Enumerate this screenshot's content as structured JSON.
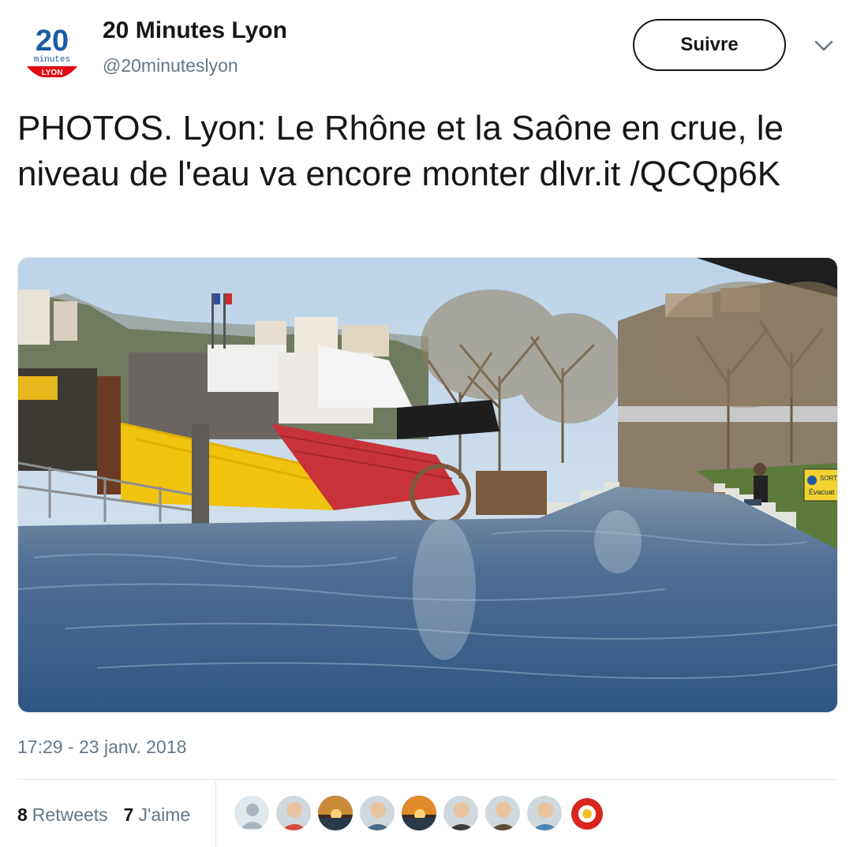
{
  "account": {
    "name": "20 Minutes Lyon",
    "handle": "@20minuteslyon",
    "logo": {
      "number": "20",
      "word": "minutes",
      "city": "LYON",
      "brand_color": "#1d5aa6",
      "accent_color": "#e30613"
    }
  },
  "follow_button": {
    "label": "Suivre"
  },
  "menu": {
    "icon": "chevron-down-icon"
  },
  "tweet": {
    "text": "PHOTOS. Lyon: Le Rhône et la Saône en crue, le niveau de l'eau va encore monter dlvr.it /QCQp6K",
    "timestamp": "17:29 - 23 janv. 2018"
  },
  "photo": {
    "sign_line1": "SORTI",
    "sign_line2": "Évacuat"
  },
  "stats": {
    "retweets_count": "8",
    "retweets_label": "Retweets",
    "likes_count": "7",
    "likes_label": "J'aime"
  },
  "likers": [
    {
      "icon": "default-avatar-icon",
      "color": "#a7b3bd"
    },
    {
      "icon": "person-avatar-icon",
      "color": "#d64a3f"
    },
    {
      "icon": "sunset-avatar-icon",
      "color": "#c98a3a"
    },
    {
      "icon": "person-avatar-icon",
      "color": "#4a6b8a"
    },
    {
      "icon": "sunset-avatar-icon",
      "color": "#e08a2a"
    },
    {
      "icon": "person-avatar-icon",
      "color": "#3b3b3b"
    },
    {
      "icon": "person-avatar-icon",
      "color": "#5b4a3a"
    },
    {
      "icon": "person-avatar-icon",
      "color": "#4a86b5"
    },
    {
      "icon": "logo-avatar-icon",
      "color": "#d8261c"
    }
  ]
}
